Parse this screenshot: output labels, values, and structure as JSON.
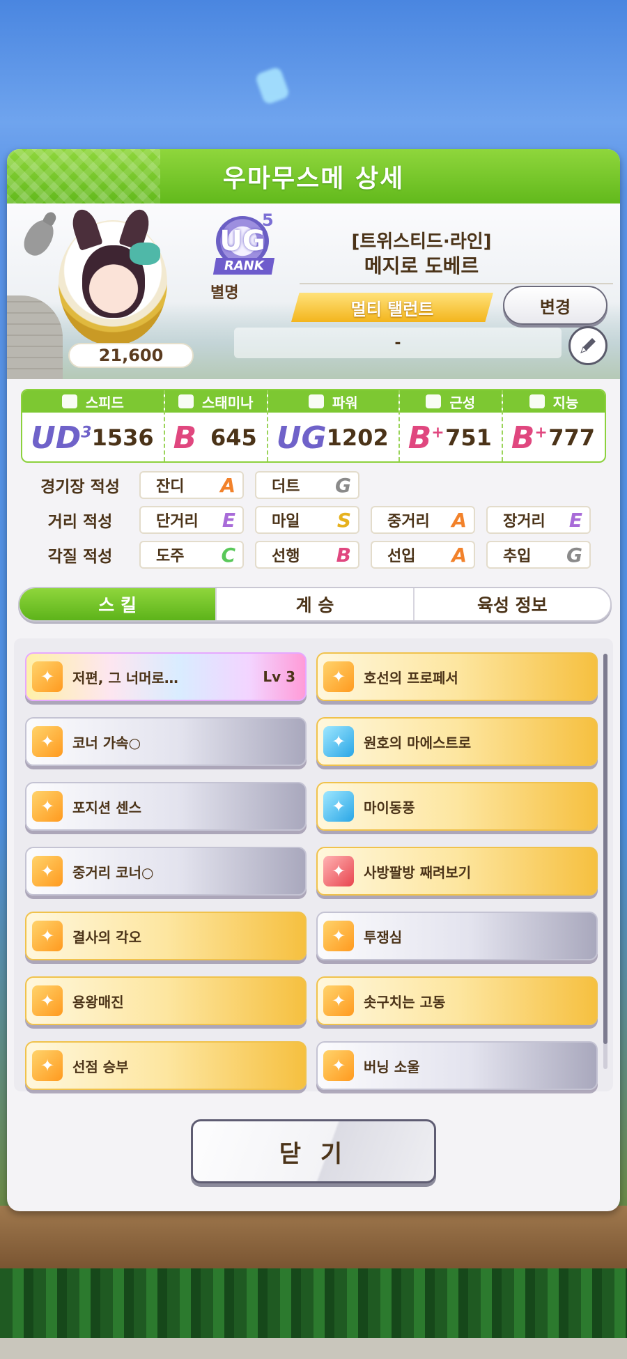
{
  "header": {
    "title": "우마무스메 상세"
  },
  "profile": {
    "score": "21,600",
    "rank_badge": {
      "letters": "UG",
      "level": "5",
      "text": "RANK"
    },
    "nickname_label": "별명",
    "epithet": "[트위스티드·라인]",
    "name": "메지로 도베르",
    "talent_banner": "멀티 탤런트",
    "change_button": "변경",
    "nickname_value": "-"
  },
  "stats": [
    {
      "label": "스피드",
      "grade": "UD",
      "grade_level": "3",
      "value": "1536",
      "icon": "shoe-icon"
    },
    {
      "label": "스태미나",
      "grade": "B",
      "grade_level": "",
      "value": "645",
      "icon": "heart-icon"
    },
    {
      "label": "파워",
      "grade": "UG",
      "grade_level": "",
      "value": "1202",
      "icon": "muscle-icon"
    },
    {
      "label": "근성",
      "grade": "B",
      "grade_level": "+",
      "value": "751",
      "icon": "flame-icon"
    },
    {
      "label": "지능",
      "grade": "B",
      "grade_level": "+",
      "value": "777",
      "icon": "graduation-cap-icon"
    }
  ],
  "aptitudes": {
    "track": {
      "label": "경기장 적성",
      "items": [
        {
          "name": "잔디",
          "grade": "A"
        },
        {
          "name": "더트",
          "grade": "G"
        }
      ]
    },
    "distance": {
      "label": "거리 적성",
      "items": [
        {
          "name": "단거리",
          "grade": "E"
        },
        {
          "name": "마일",
          "grade": "S"
        },
        {
          "name": "중거리",
          "grade": "A"
        },
        {
          "name": "장거리",
          "grade": "E"
        }
      ]
    },
    "style": {
      "label": "각질 적성",
      "items": [
        {
          "name": "도주",
          "grade": "C"
        },
        {
          "name": "선행",
          "grade": "B"
        },
        {
          "name": "선입",
          "grade": "A"
        },
        {
          "name": "추입",
          "grade": "G"
        }
      ]
    }
  },
  "tabs": [
    {
      "label": "스 킬",
      "active": true
    },
    {
      "label": "계 승",
      "active": false
    },
    {
      "label": "육성 정보",
      "active": false
    }
  ],
  "skills": [
    {
      "name": "저편, 그 너머로…",
      "level": "Lv 3",
      "style": "rainbow",
      "icon_color": "orange"
    },
    {
      "name": "호선의 프로페서",
      "level": "",
      "style": "gold",
      "icon_color": "orange"
    },
    {
      "name": "코너 가속○",
      "level": "",
      "style": "gray",
      "icon_color": "orange"
    },
    {
      "name": "원호의 마에스트로",
      "level": "",
      "style": "gold",
      "icon_color": "blue"
    },
    {
      "name": "포지션 센스",
      "level": "",
      "style": "gray",
      "icon_color": "orange"
    },
    {
      "name": "마이동풍",
      "level": "",
      "style": "gold",
      "icon_color": "blue"
    },
    {
      "name": "중거리 코너○",
      "level": "",
      "style": "gray",
      "icon_color": "orange"
    },
    {
      "name": "사방팔방 째려보기",
      "level": "",
      "style": "gold",
      "icon_color": "red"
    },
    {
      "name": "결사의 각오",
      "level": "",
      "style": "gold",
      "icon_color": "orange"
    },
    {
      "name": "투쟁심",
      "level": "",
      "style": "gray",
      "icon_color": "orange"
    },
    {
      "name": "용왕매진",
      "level": "",
      "style": "gold",
      "icon_color": "orange"
    },
    {
      "name": "솟구치는 고동",
      "level": "",
      "style": "gold",
      "icon_color": "orange"
    },
    {
      "name": "선점 승부",
      "level": "",
      "style": "gold",
      "icon_color": "orange"
    },
    {
      "name": "버닝 소울",
      "level": "",
      "style": "gray",
      "icon_color": "orange"
    }
  ],
  "footer": {
    "close_button": "닫 기"
  }
}
